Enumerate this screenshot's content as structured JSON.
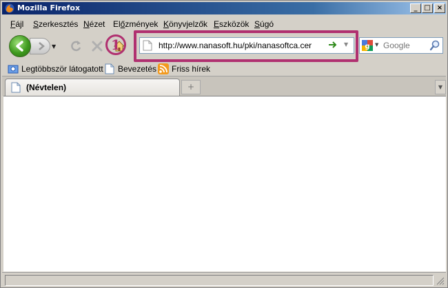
{
  "window": {
    "title": "Mozilla Firefox"
  },
  "window_controls": {
    "minimize": "_",
    "maximize": "□",
    "close": "×"
  },
  "menu": [
    {
      "label": "Fájl",
      "accel": "F",
      "rest": "ájl"
    },
    {
      "label": "Szerkesztés",
      "accel": "S",
      "rest": "zerkesztés"
    },
    {
      "label": "Nézet",
      "accel": "N",
      "rest": "ézet"
    },
    {
      "label": "Előzmények",
      "accel": "",
      "pre": "El",
      "u": "ő",
      "post": "zmények"
    },
    {
      "label": "Könyvjelzők",
      "accel": "K",
      "rest": "önyvjelzők"
    },
    {
      "label": "Eszközök",
      "accel": "E",
      "rest": "szközök"
    },
    {
      "label": "Súgó",
      "accel": "S",
      "rest": "úgó"
    }
  ],
  "toolbar": {
    "annotation_number": "1",
    "url": "http://www.nanasoft.hu/pki/nanasoftca.cer",
    "search_placeholder": "Google"
  },
  "bookmarks": [
    {
      "label": "Legtöbbször látogatott",
      "icon": "folder-search-icon"
    },
    {
      "label": "Bevezetés",
      "icon": "page-icon"
    },
    {
      "label": "Friss hírek",
      "icon": "rss-icon"
    }
  ],
  "tabs": [
    {
      "label": "(Névtelen)"
    }
  ],
  "colors": {
    "annotation": "#b03070",
    "titlebar_start": "#0a246a",
    "go_arrow": "#2f8a1b"
  }
}
